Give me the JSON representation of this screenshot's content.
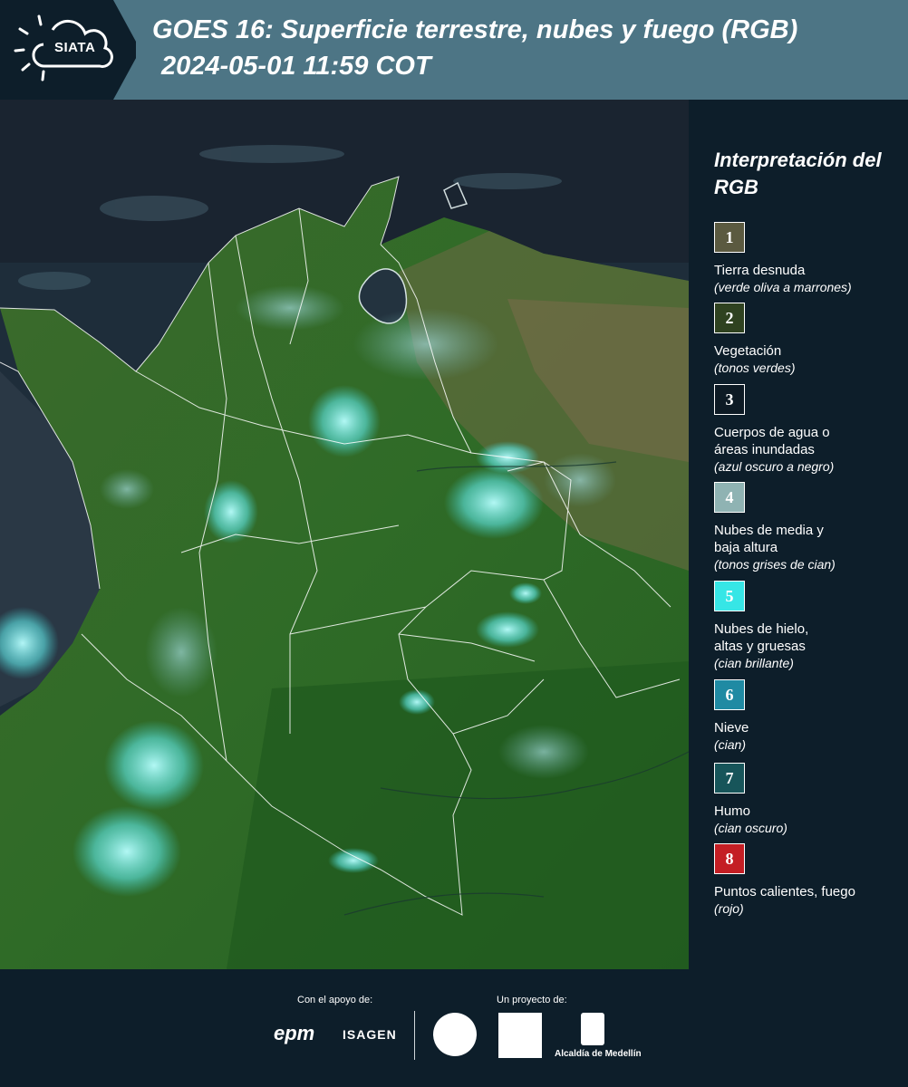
{
  "header": {
    "logo_text": "SIATA",
    "title": "GOES 16: Superficie terrestre, nubes y fuego (RGB)",
    "subtitle": "2024-05-01 11:59 COT"
  },
  "legend": {
    "title": "Interpretación del RGB",
    "items": [
      {
        "num": "1",
        "color": "#5b5a40",
        "label": "Tierra desnuda",
        "sub": "(verde oliva a marrones)"
      },
      {
        "num": "2",
        "color": "#2f4220",
        "label": "Vegetación",
        "sub": "(tonos verdes)"
      },
      {
        "num": "3",
        "color": "#0d1a24",
        "label": "Cuerpos de agua o áreas inundadas",
        "sub": "(azul oscuro a negro)"
      },
      {
        "num": "4",
        "color": "#8fb3b3",
        "label": "Nubes de media y baja altura",
        "sub": "(tonos grises de cian)"
      },
      {
        "num": "5",
        "color": "#36e6e6",
        "label": "Nubes de hielo, altas y gruesas",
        "sub": "(cian brillante)"
      },
      {
        "num": "6",
        "color": "#1f8aa3",
        "label": "Nieve",
        "sub": "(cian)"
      },
      {
        "num": "7",
        "color": "#17555a",
        "label": "Humo",
        "sub": "(cian oscuro)"
      },
      {
        "num": "8",
        "color": "#c41e24",
        "label": "Puntos calientes, fuego",
        "sub": "(rojo)"
      }
    ]
  },
  "footer": {
    "support_label": "Con el apoyo de:",
    "project_label": "Un proyecto de:",
    "epm": "epm",
    "isagen": "ISAGEN",
    "alcaldia": "Alcaldía de Medellín"
  }
}
